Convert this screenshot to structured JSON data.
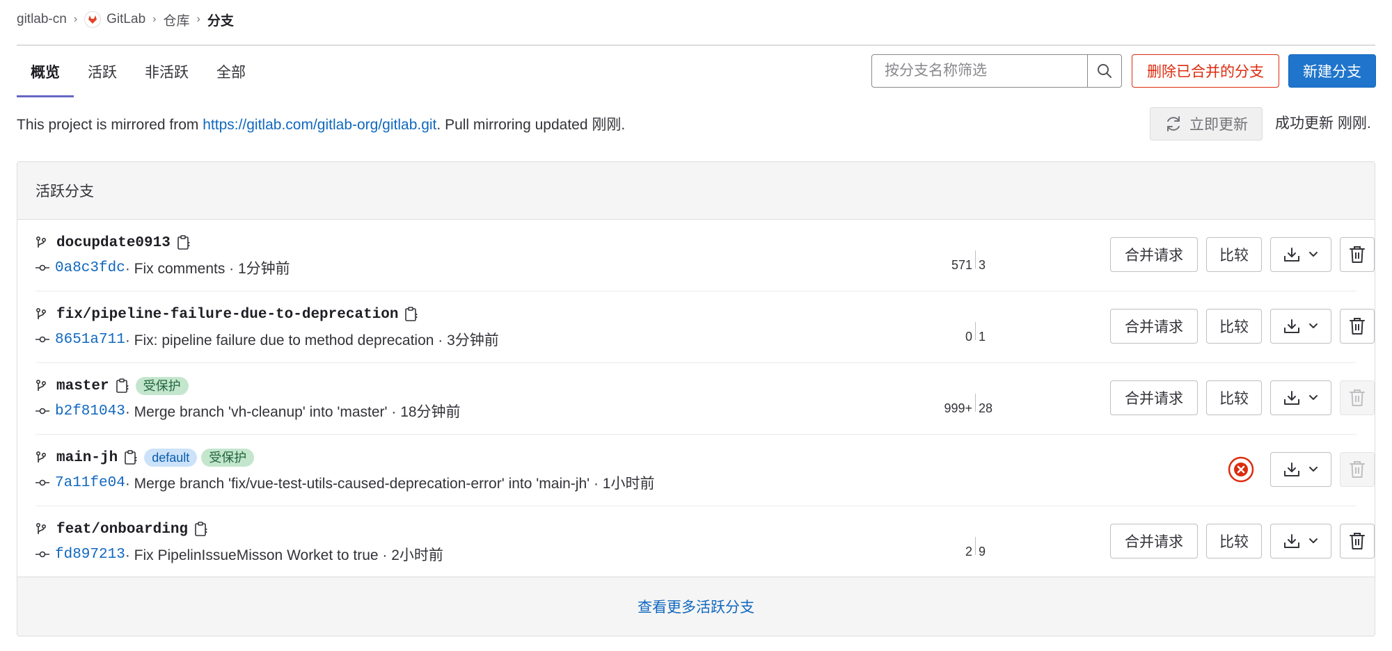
{
  "breadcrumb": {
    "items": [
      "gitlab-cn",
      "GitLab",
      "仓库"
    ],
    "current": "分支"
  },
  "tabs": [
    "概览",
    "活跃",
    "非活跃",
    "全部"
  ],
  "search": {
    "placeholder": "按分支名称筛选"
  },
  "actions": {
    "delete_merged_label": "删除已合并的分支",
    "new_branch_label": "新建分支"
  },
  "mirror": {
    "prefix": "This project is mirrored from ",
    "url": "https://gitlab.com/gitlab-org/gitlab.git",
    "suffix": ". Pull mirroring updated 刚刚.",
    "update_button_label": "立即更新",
    "update_status": "成功更新 刚刚."
  },
  "panel": {
    "title": "活跃分支",
    "row_actions": {
      "merge_request_label": "合并请求",
      "compare_label": "比较"
    },
    "branches": [
      {
        "name": "docupdate0913",
        "badges": [],
        "sha": "0a8c3fdc",
        "meta": " · Fix comments · 1分钟前",
        "behind": "571",
        "ahead": "3"
      },
      {
        "name": "fix/pipeline-failure-due-to-deprecation",
        "badges": [],
        "sha": "8651a711",
        "meta": " · Fix: pipeline failure due to method deprecation · 3分钟前",
        "behind": "0",
        "ahead": "1"
      },
      {
        "name": "master",
        "badges": [
          "受保护"
        ],
        "sha": "b2f81043",
        "meta": " · Merge branch 'vh-cleanup' into 'master' · 18分钟前",
        "behind": "999+",
        "ahead": "28"
      },
      {
        "name": "main-jh",
        "badges": [
          "default",
          "受保护"
        ],
        "sha": "7a11fe04",
        "meta": " · Merge branch 'fix/vue-test-utils-caused-deprecation-error' into 'main-jh' · 1小时前"
      },
      {
        "name": "feat/onboarding",
        "badges": [],
        "sha": "fd897213",
        "meta": " · Fix PipelinIssueMisson Worket to true · 2小时前",
        "behind": "2",
        "ahead": "9"
      }
    ],
    "footer_link": "查看更多活跃分支"
  },
  "colors": {
    "primary": "#1f75cb",
    "danger": "#dd2b0e",
    "link": "#1068bf",
    "protected_badge_bg": "#c3e6cd",
    "default_badge_bg": "#cbe2f9",
    "active_tab_underline": "#6666c4"
  },
  "icons": {
    "search": "search-icon",
    "refresh": "refresh-icon",
    "branch": "branch-icon",
    "copy": "copy-icon",
    "commit": "commit-icon",
    "download": "download-icon",
    "chevron": "chevron-down-icon",
    "delete": "trash-icon",
    "pipeline_failed": "status-failed-icon"
  }
}
